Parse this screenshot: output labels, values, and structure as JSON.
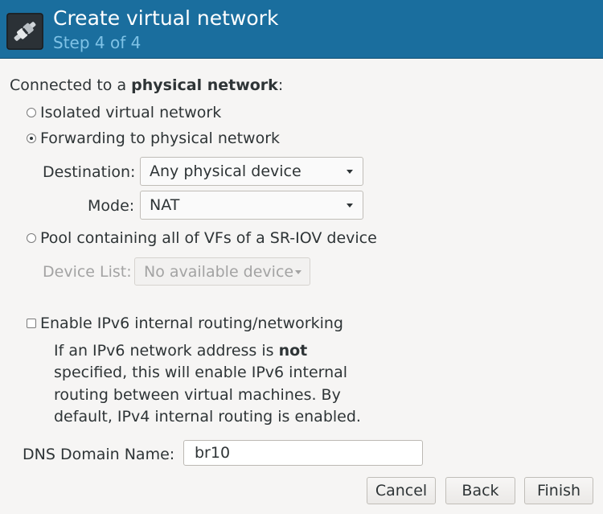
{
  "header": {
    "title": "Create virtual network",
    "subtitle": "Step 4 of 4",
    "icon": "network-wizard-icon",
    "background": "#1a6e9e",
    "subtitle_color": "#7fc2e6"
  },
  "connection": {
    "prefix": "Connected to a ",
    "bold": "physical network",
    "suffix": ":"
  },
  "options": {
    "isolated": {
      "label": "Isolated virtual network",
      "checked": false
    },
    "forwarding": {
      "label": "Forwarding to physical network",
      "checked": true
    },
    "sriov": {
      "label": "Pool containing all of VFs of a SR-IOV device",
      "checked": false
    }
  },
  "destination": {
    "label": "Destination:",
    "value": "Any physical device"
  },
  "mode": {
    "label": "Mode:",
    "value": "NAT"
  },
  "device_list": {
    "label": "Device List:",
    "value": "No available device",
    "enabled": false
  },
  "ipv6": {
    "label": "Enable IPv6 internal routing/networking",
    "checked": false,
    "desc_line1_prefix": "If an IPv6 network address is ",
    "desc_line1_bold": "not",
    "desc_line2": "specified, this will enable IPv6 internal",
    "desc_line3": "routing between virtual machines.  By",
    "desc_line4": "default, IPv4 internal routing is enabled."
  },
  "dns": {
    "label": "DNS Domain Name:",
    "value": "br10"
  },
  "buttons": {
    "cancel": "Cancel",
    "back": "Back",
    "finish": "Finish"
  }
}
